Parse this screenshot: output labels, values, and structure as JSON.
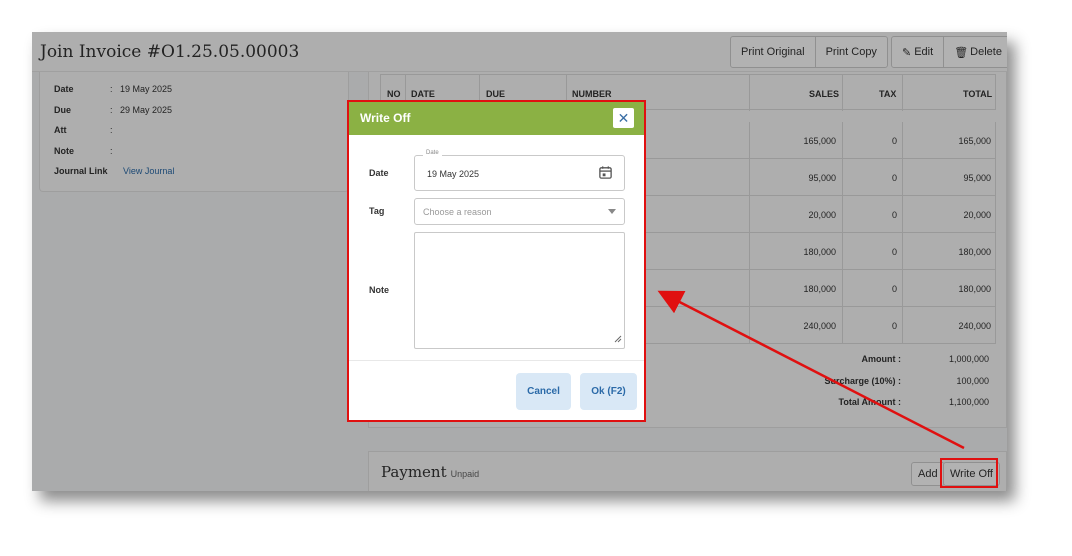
{
  "header": {
    "title": "Join Invoice #O1.25.05.00003",
    "print_original": "Print Original",
    "print_copy": "Print Copy",
    "edit": "Edit",
    "delete": "Delete"
  },
  "info": {
    "rows": [
      {
        "label": "Date",
        "value": "19 May 2025"
      },
      {
        "label": "Due",
        "value": "29 May 2025"
      },
      {
        "label": "Att",
        "value": ""
      },
      {
        "label": "Note",
        "value": ""
      },
      {
        "label": "Journal Link",
        "value": "View Journal"
      }
    ]
  },
  "table": {
    "headers": [
      "NO",
      "DATE",
      "DUE",
      "NUMBER",
      "SALES",
      "TAX",
      "TOTAL"
    ],
    "rows": [
      {
        "sales": "165,000",
        "tax": "0",
        "total": "165,000"
      },
      {
        "sales": "95,000",
        "tax": "0",
        "total": "95,000"
      },
      {
        "sales": "20,000",
        "tax": "0",
        "total": "20,000"
      },
      {
        "sales": "180,000",
        "tax": "0",
        "total": "180,000"
      },
      {
        "sales": "180,000",
        "tax": "0",
        "total": "180,000"
      },
      {
        "sales": "240,000",
        "tax": "0",
        "total": "240,000"
      }
    ],
    "totals": [
      {
        "label": "Amount :",
        "value": "1,000,000"
      },
      {
        "label": "Surcharge (10%) :",
        "value": "100,000"
      },
      {
        "label": "Total Amount :",
        "value": "1,100,000"
      }
    ]
  },
  "payment": {
    "title": "Payment",
    "status": "Unpaid",
    "add": "Add",
    "write_off": "Write Off"
  },
  "modal": {
    "title": "Write Off",
    "close": "✕",
    "date_label": "Date",
    "date_legend": "Date",
    "date_value": "19 May 2025",
    "tag_label": "Tag",
    "tag_placeholder": "Choose a reason",
    "note_label": "Note",
    "cancel": "Cancel",
    "ok": "Ok (F2)"
  },
  "colors": {
    "modal_header": "#8bb144",
    "highlight": "#e01010",
    "link": "#2b6aa8"
  }
}
